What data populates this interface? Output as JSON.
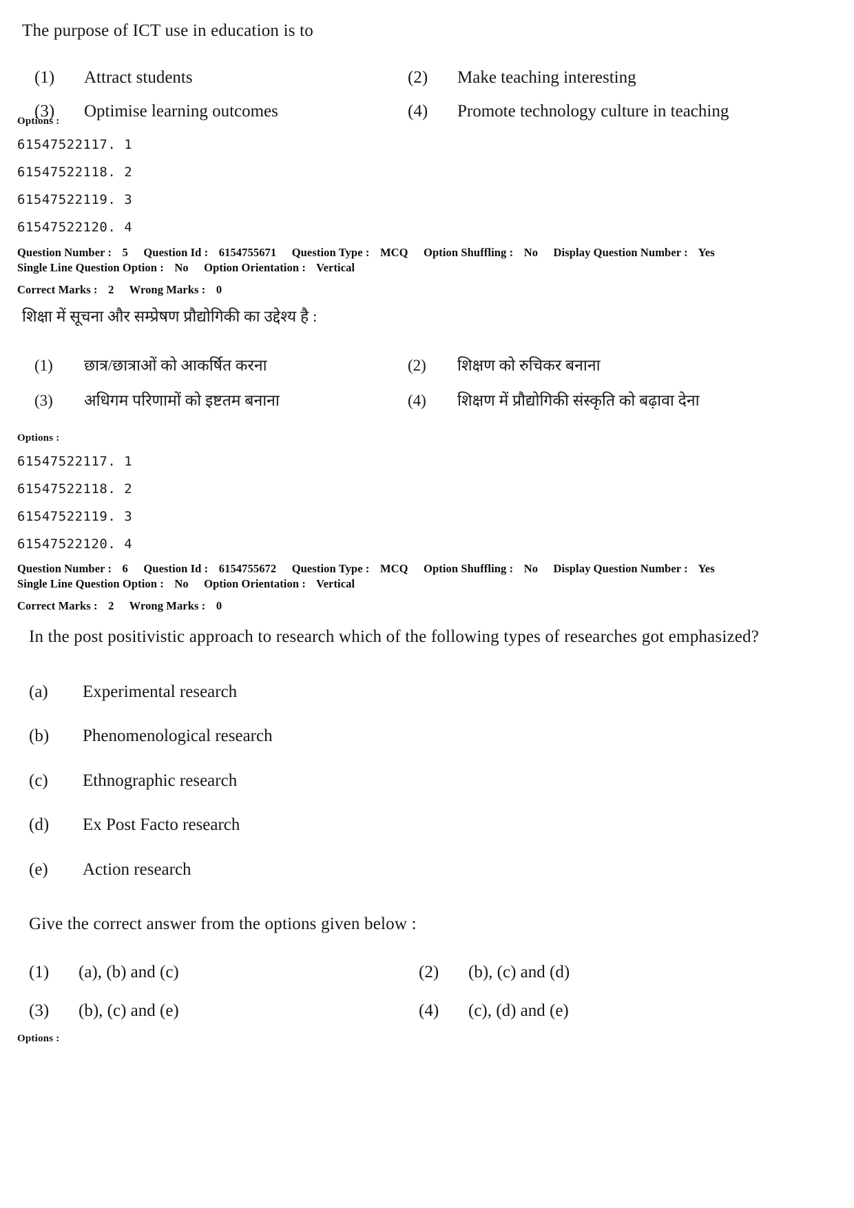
{
  "document": {
    "type": "exam-question-paper",
    "language_pair": "English / Hindi"
  },
  "question5_en": {
    "stem": "The purpose of ICT use in education is to",
    "options": [
      {
        "num": "(1)",
        "text": "Attract students"
      },
      {
        "num": "(2)",
        "text": "Make teaching interesting"
      },
      {
        "num": "(3)",
        "text": "Optimise learning outcomes"
      },
      {
        "num": "(4)",
        "text": "Promote technology culture in teaching"
      }
    ],
    "options_label": "Options :",
    "option_ids": [
      "61547522117. 1",
      "61547522118. 2",
      "61547522119. 3",
      "61547522120. 4"
    ]
  },
  "meta5": {
    "line1": {
      "question_number_label": "Question Number :",
      "question_number": "5",
      "question_id_label": "Question Id :",
      "question_id": "6154755671",
      "question_type_label": "Question Type :",
      "question_type": "MCQ",
      "option_shuffling_label": "Option Shuffling :",
      "option_shuffling": "No",
      "display_question_number_label": "Display Question Number :",
      "display_question_number": "Yes"
    },
    "line2": {
      "single_line_question_option_label": "Single Line Question Option :",
      "single_line_question_option": "No",
      "option_orientation_label": "Option Orientation :",
      "option_orientation": "Vertical"
    },
    "line3": {
      "correct_marks_label": "Correct Marks :",
      "correct_marks": "2",
      "wrong_marks_label": "Wrong Marks :",
      "wrong_marks": "0"
    }
  },
  "question5_hi": {
    "stem": "शिक्षा में सूचना और सम्प्रेषण प्रौद्योगिकी का उद्देश्य है :",
    "options": [
      {
        "num": "(1)",
        "text": "छात्र/छात्राओं को आकर्षित करना"
      },
      {
        "num": "(2)",
        "text": "शिक्षण को रुचिकर बनाना"
      },
      {
        "num": "(3)",
        "text": "अधिगम परिणामों को इष्टतम बनाना"
      },
      {
        "num": "(4)",
        "text": "शिक्षण में प्रौद्योगिकी संस्कृति को बढ़ावा देना"
      }
    ],
    "options_label": "Options :",
    "option_ids": [
      "61547522117. 1",
      "61547522118. 2",
      "61547522119. 3",
      "61547522120. 4"
    ]
  },
  "meta6": {
    "line1": {
      "question_number_label": "Question Number :",
      "question_number": "6",
      "question_id_label": "Question Id :",
      "question_id": "6154755672",
      "question_type_label": "Question Type :",
      "question_type": "MCQ",
      "option_shuffling_label": "Option Shuffling :",
      "option_shuffling": "No",
      "display_question_number_label": "Display Question Number :",
      "display_question_number": "Yes"
    },
    "line2": {
      "single_line_question_option_label": "Single Line Question Option :",
      "single_line_question_option": "No",
      "option_orientation_label": "Option Orientation :",
      "option_orientation": "Vertical"
    },
    "line3": {
      "correct_marks_label": "Correct Marks :",
      "correct_marks": "2",
      "wrong_marks_label": "Wrong Marks :",
      "wrong_marks": "0"
    }
  },
  "question6_en": {
    "stem": "In the post positivistic approach to research which of the following types of researches got emphasized?",
    "items": [
      {
        "key": "(a)",
        "text": "Experimental research"
      },
      {
        "key": "(b)",
        "text": "Phenomenological research"
      },
      {
        "key": "(c)",
        "text": "Ethnographic research"
      },
      {
        "key": "(d)",
        "text": "Ex Post Facto research"
      },
      {
        "key": "(e)",
        "text": "Action research"
      }
    ],
    "instruction": "Give the correct answer from the options given below :",
    "options": [
      {
        "num": "(1)",
        "text": "(a), (b) and (c)"
      },
      {
        "num": "(2)",
        "text": "(b), (c) and (d)"
      },
      {
        "num": "(3)",
        "text": "(b), (c) and (e)"
      },
      {
        "num": "(4)",
        "text": "(c), (d) and (e)"
      }
    ],
    "options_label": "Options :"
  }
}
